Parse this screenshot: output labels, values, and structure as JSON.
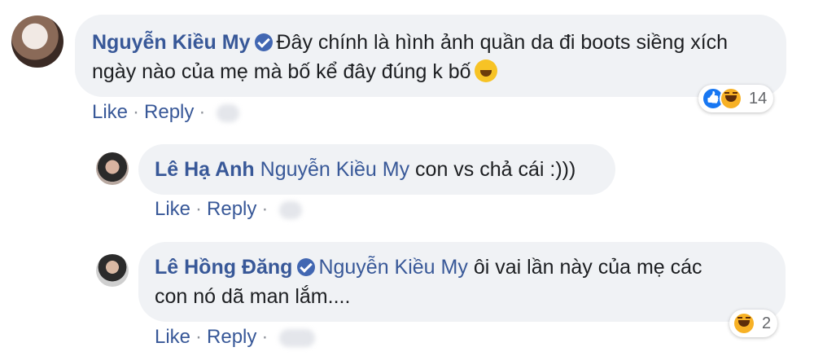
{
  "comments": [
    {
      "author": "Nguyễn Kiều My",
      "verified": true,
      "line1": "Đây chính là hình ảnh quần da đi boots siềng xích",
      "line2": "ngày nào của mẹ mà bố kể đây đúng k bố",
      "actions": {
        "like": "Like",
        "reply": "Reply"
      },
      "reaction_count": "14",
      "reactions": [
        "like",
        "haha"
      ]
    },
    {
      "author": "Lê Hạ Anh",
      "verified": false,
      "mention": "Nguyễn Kiều My",
      "line1": "con vs chả cái :)))",
      "actions": {
        "like": "Like",
        "reply": "Reply"
      }
    },
    {
      "author": "Lê Hồng Đăng",
      "verified": true,
      "mention": "Nguyễn Kiều My",
      "line1": "ôi vai lần này của mẹ các",
      "line2": "con nó dã man lắm....",
      "actions": {
        "like": "Like",
        "reply": "Reply"
      },
      "reaction_count": "2",
      "reactions": [
        "haha"
      ]
    }
  ],
  "separator": "·",
  "colors": {
    "name": "#385898",
    "bubble": "#f0f2f5",
    "like": "#1877f2",
    "haha": "#f7b125"
  }
}
